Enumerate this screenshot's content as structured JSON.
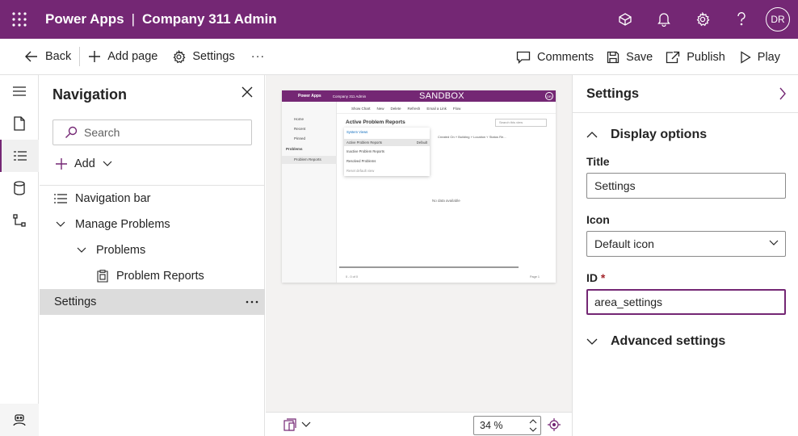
{
  "topbar": {
    "product": "Power Apps",
    "separator": "|",
    "app_name": "Company 311 Admin",
    "avatar_initials": "DR",
    "icons": [
      "waffle-icon",
      "environment-icon",
      "bell-icon",
      "gear-icon",
      "help-icon"
    ]
  },
  "commandbar": {
    "back": "Back",
    "add_page": "Add page",
    "settings": "Settings",
    "more": "···",
    "comments": "Comments",
    "save": "Save",
    "publish": "Publish",
    "play": "Play"
  },
  "navigation": {
    "title": "Navigation",
    "search_placeholder": "Search",
    "add": "Add",
    "items": [
      {
        "label": "Navigation bar"
      },
      {
        "label": "Manage Problems"
      },
      {
        "label": "Problems"
      },
      {
        "label": "Problem Reports"
      },
      {
        "label": "Settings"
      }
    ],
    "more": "···"
  },
  "preview": {
    "app": "Power Apps",
    "company": "Company 311 Admin",
    "sandbox": "SANDBOX",
    "avatar": "DR",
    "side_items": [
      "Home",
      "Recent",
      "Pinned",
      "Problems",
      "Problem Reports"
    ],
    "commands": [
      "Show Chart",
      "New",
      "Delete",
      "Refresh",
      "Email a Link",
      "Flow"
    ],
    "view_title": "Active Problem Reports",
    "search": "Search this view",
    "columns": "Created On ˅      Building ˅      Location ˅      Status Re...",
    "dropdown": {
      "header": "System Views",
      "items": [
        "Active Problem Reports",
        "Inactive Problem Reports",
        "Resolved Problems"
      ],
      "default_tag": "Default",
      "reset": "Reset default view"
    },
    "no_data": "No data available",
    "footer": "0 - 0 of 0",
    "page": "Page 1"
  },
  "canvas": {
    "zoom": "34 %"
  },
  "settings": {
    "title": "Settings",
    "display_options": "Display options",
    "title_label": "Title",
    "title_value": "Settings",
    "icon_label": "Icon",
    "icon_value": "Default icon",
    "id_label": "ID",
    "id_required": "*",
    "id_value": "area_settings",
    "advanced": "Advanced settings"
  },
  "colors": {
    "brand": "#742774",
    "required": "#a4262c"
  }
}
